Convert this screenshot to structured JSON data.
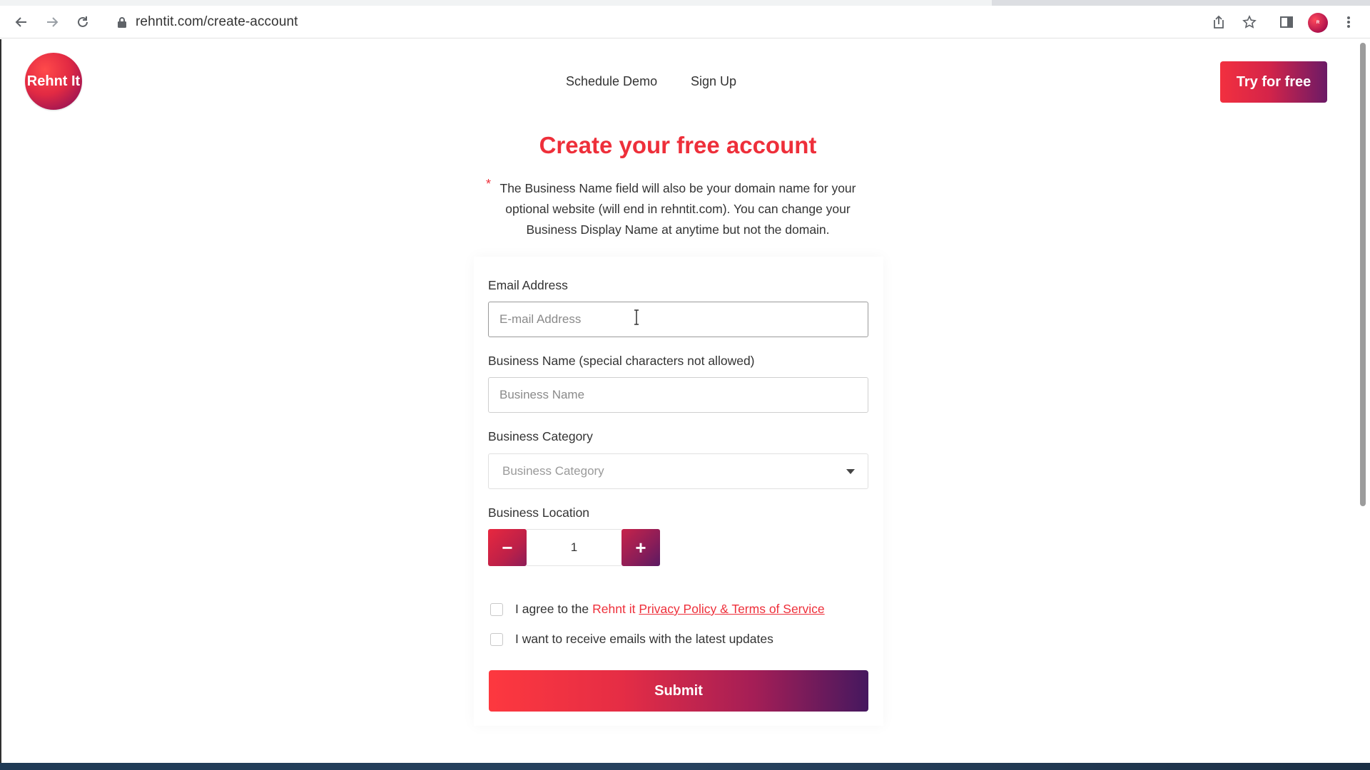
{
  "browser": {
    "url": "rehntit.com/create-account"
  },
  "header": {
    "logo_text": "Rehnt It",
    "nav": [
      {
        "label": "Schedule Demo"
      },
      {
        "label": "Sign Up"
      }
    ],
    "cta_label": "Try for free"
  },
  "main": {
    "title": "Create your free account",
    "note": {
      "star": "*",
      "text": "The Business Name field will also be your domain name for your optional website (will end in rehntit.com). You can change your Business Display Name at anytime but not the domain."
    },
    "form": {
      "email_label": "Email Address",
      "email_placeholder": "E-mail Address",
      "business_name_label": "Business Name (special characters not allowed)",
      "business_name_placeholder": "Business Name",
      "category_label": "Business Category",
      "category_selected": "Business Category",
      "location_label": "Business Location",
      "location_value": "1",
      "minus_label": "−",
      "plus_label": "+",
      "agree_text": "I agree to the",
      "agree_link_prefix": "Rehnt it",
      "agree_link": "Privacy Policy & Terms of Service",
      "updates_text": "I want to receive emails with the latest updates",
      "submit_label": "Submit"
    }
  },
  "colors": {
    "accent_red": "#ee2f3a",
    "gradient_start": "#fd383f",
    "gradient_end": "#45185f"
  }
}
